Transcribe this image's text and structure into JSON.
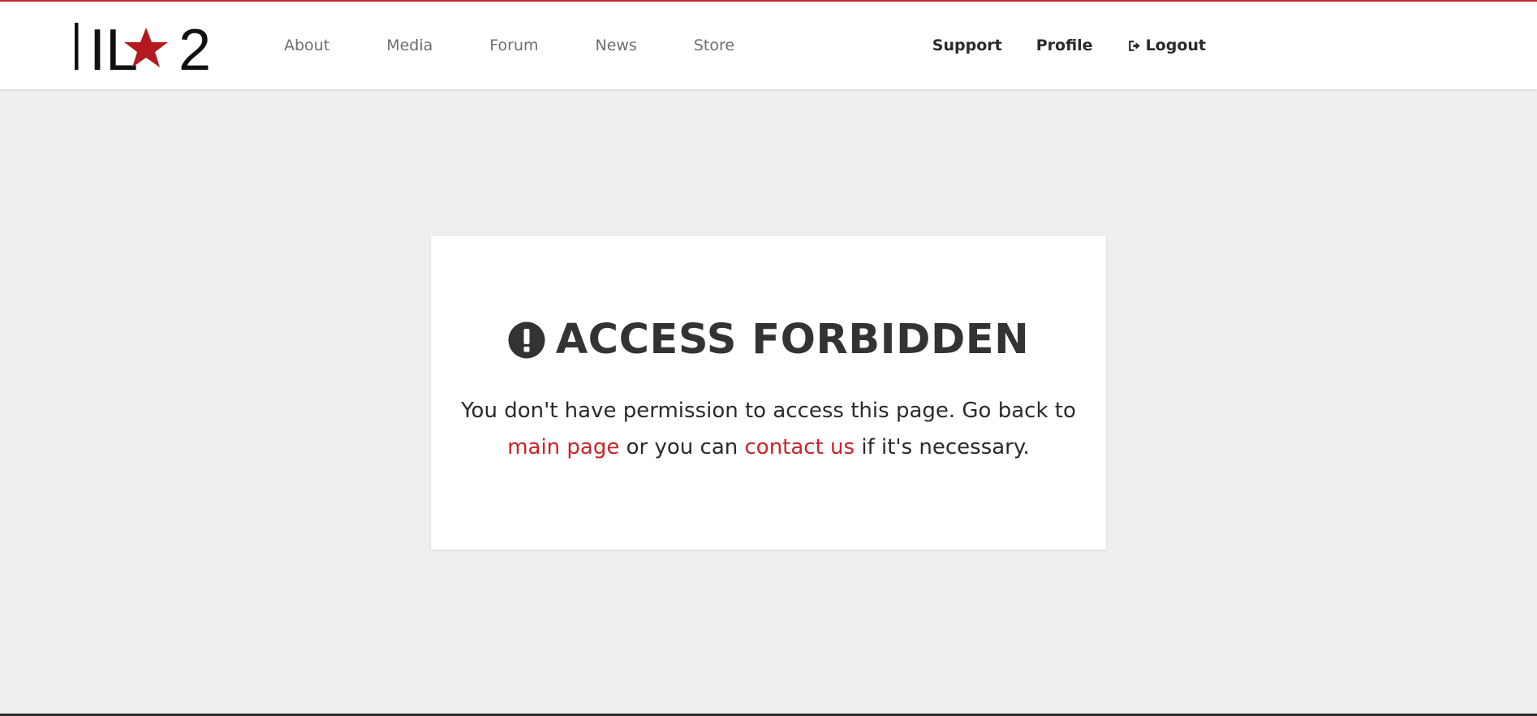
{
  "brand": {
    "logo_text_left": "IL",
    "logo_text_right": "2",
    "accent_color": "#c8242b"
  },
  "nav": {
    "left_items": [
      {
        "label": "About"
      },
      {
        "label": "Media"
      },
      {
        "label": "Forum"
      },
      {
        "label": "News"
      },
      {
        "label": "Store"
      }
    ],
    "right_items": {
      "support": "Support",
      "profile": "Profile",
      "logout": "Logout",
      "logout_icon": "sign-out-icon"
    }
  },
  "error": {
    "icon": "exclamation-circle-icon",
    "title": "ACCESS FORBIDDEN",
    "message_part1": "You don't have permission to access this page. Go back to ",
    "link_main_page": "main page",
    "message_part2": " or you can ",
    "link_contact": "contact us",
    "message_part3": " if it's necessary."
  }
}
